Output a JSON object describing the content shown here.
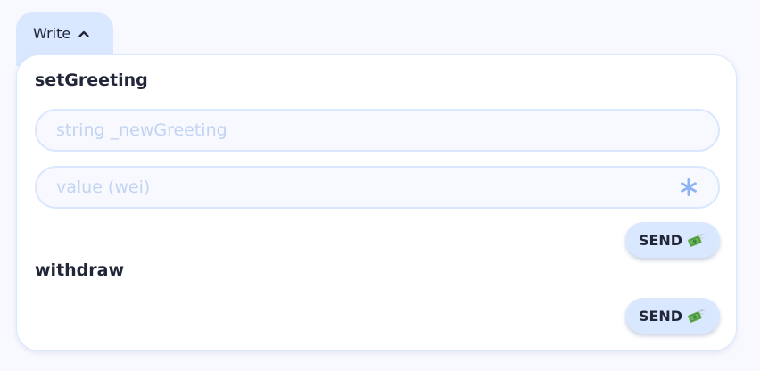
{
  "tab": {
    "label": "Write"
  },
  "functions": [
    {
      "name": "setGreeting",
      "inputs": [
        {
          "placeholder": "string _newGreeting",
          "value": ""
        },
        {
          "placeholder": "value (wei)",
          "value": ""
        }
      ],
      "send_label": "SEND"
    },
    {
      "name": "withdraw",
      "send_label": "SEND"
    }
  ],
  "icons": {
    "tab_toggle": "chevron-up-icon",
    "value_multiplier": "asterisk-icon",
    "send": "money-with-wings-icon"
  },
  "colors": {
    "accent": "#dae8ff",
    "text": "#212638",
    "placeholder": "#c2d4f2",
    "asterisk": "#8fb4f4",
    "background": "#f8f9fe"
  }
}
